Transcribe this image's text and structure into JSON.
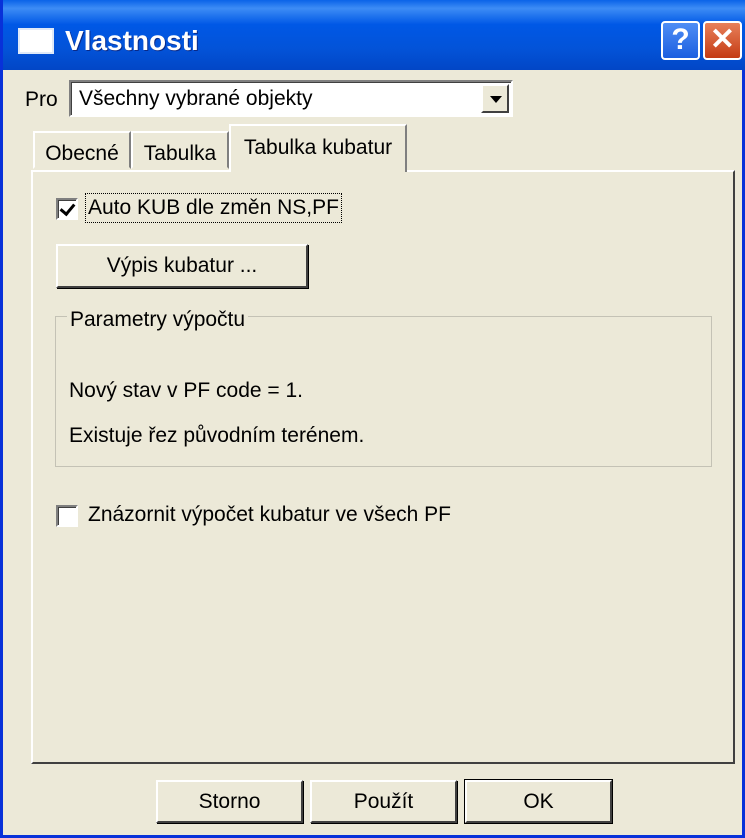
{
  "window": {
    "title": "Vlastnosti",
    "help_glyph": "?",
    "close_glyph": "✕"
  },
  "pro": {
    "label": "Pro",
    "selected": "Všechny vybrané objekty"
  },
  "tabs": [
    {
      "label": "Obecné"
    },
    {
      "label": "Tabulka"
    },
    {
      "label": "Tabulka kubatur",
      "active": true
    }
  ],
  "panel": {
    "auto_kub": {
      "label": "Auto KUB dle změn NS,PF",
      "checked": true
    },
    "vypis_button": "Výpis kubatur ...",
    "group": {
      "title": "Parametry výpočtu",
      "line1": "Nový stav v PF code = 1.",
      "line2": "Existuje řez původním terénem."
    },
    "znazornit": {
      "label": "Znázornit výpočet kubatur ve všech PF",
      "checked": false
    }
  },
  "footer": {
    "storno": "Storno",
    "pouzit": "Použít",
    "ok": "OK"
  }
}
